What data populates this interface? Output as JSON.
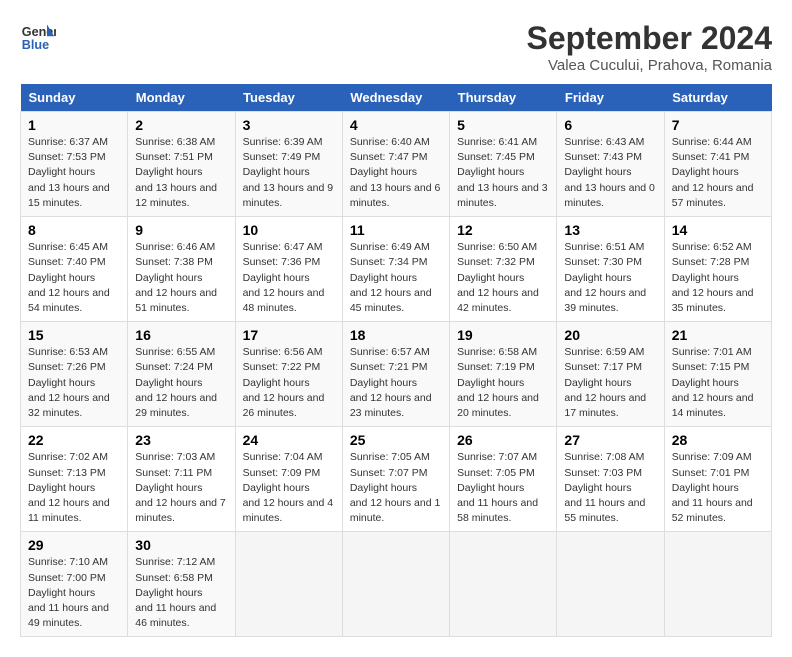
{
  "header": {
    "logo_line1": "General",
    "logo_line2": "Blue",
    "month": "September 2024",
    "location": "Valea Cucului, Prahova, Romania"
  },
  "weekdays": [
    "Sunday",
    "Monday",
    "Tuesday",
    "Wednesday",
    "Thursday",
    "Friday",
    "Saturday"
  ],
  "weeks": [
    [
      {
        "day": "1",
        "rise": "6:37 AM",
        "set": "7:53 PM",
        "daylight": "13 hours and 15 minutes."
      },
      {
        "day": "2",
        "rise": "6:38 AM",
        "set": "7:51 PM",
        "daylight": "13 hours and 12 minutes."
      },
      {
        "day": "3",
        "rise": "6:39 AM",
        "set": "7:49 PM",
        "daylight": "13 hours and 9 minutes."
      },
      {
        "day": "4",
        "rise": "6:40 AM",
        "set": "7:47 PM",
        "daylight": "13 hours and 6 minutes."
      },
      {
        "day": "5",
        "rise": "6:41 AM",
        "set": "7:45 PM",
        "daylight": "13 hours and 3 minutes."
      },
      {
        "day": "6",
        "rise": "6:43 AM",
        "set": "7:43 PM",
        "daylight": "13 hours and 0 minutes."
      },
      {
        "day": "7",
        "rise": "6:44 AM",
        "set": "7:41 PM",
        "daylight": "12 hours and 57 minutes."
      }
    ],
    [
      {
        "day": "8",
        "rise": "6:45 AM",
        "set": "7:40 PM",
        "daylight": "12 hours and 54 minutes."
      },
      {
        "day": "9",
        "rise": "6:46 AM",
        "set": "7:38 PM",
        "daylight": "12 hours and 51 minutes."
      },
      {
        "day": "10",
        "rise": "6:47 AM",
        "set": "7:36 PM",
        "daylight": "12 hours and 48 minutes."
      },
      {
        "day": "11",
        "rise": "6:49 AM",
        "set": "7:34 PM",
        "daylight": "12 hours and 45 minutes."
      },
      {
        "day": "12",
        "rise": "6:50 AM",
        "set": "7:32 PM",
        "daylight": "12 hours and 42 minutes."
      },
      {
        "day": "13",
        "rise": "6:51 AM",
        "set": "7:30 PM",
        "daylight": "12 hours and 39 minutes."
      },
      {
        "day": "14",
        "rise": "6:52 AM",
        "set": "7:28 PM",
        "daylight": "12 hours and 35 minutes."
      }
    ],
    [
      {
        "day": "15",
        "rise": "6:53 AM",
        "set": "7:26 PM",
        "daylight": "12 hours and 32 minutes."
      },
      {
        "day": "16",
        "rise": "6:55 AM",
        "set": "7:24 PM",
        "daylight": "12 hours and 29 minutes."
      },
      {
        "day": "17",
        "rise": "6:56 AM",
        "set": "7:22 PM",
        "daylight": "12 hours and 26 minutes."
      },
      {
        "day": "18",
        "rise": "6:57 AM",
        "set": "7:21 PM",
        "daylight": "12 hours and 23 minutes."
      },
      {
        "day": "19",
        "rise": "6:58 AM",
        "set": "7:19 PM",
        "daylight": "12 hours and 20 minutes."
      },
      {
        "day": "20",
        "rise": "6:59 AM",
        "set": "7:17 PM",
        "daylight": "12 hours and 17 minutes."
      },
      {
        "day": "21",
        "rise": "7:01 AM",
        "set": "7:15 PM",
        "daylight": "12 hours and 14 minutes."
      }
    ],
    [
      {
        "day": "22",
        "rise": "7:02 AM",
        "set": "7:13 PM",
        "daylight": "12 hours and 11 minutes."
      },
      {
        "day": "23",
        "rise": "7:03 AM",
        "set": "7:11 PM",
        "daylight": "12 hours and 7 minutes."
      },
      {
        "day": "24",
        "rise": "7:04 AM",
        "set": "7:09 PM",
        "daylight": "12 hours and 4 minutes."
      },
      {
        "day": "25",
        "rise": "7:05 AM",
        "set": "7:07 PM",
        "daylight": "12 hours and 1 minute."
      },
      {
        "day": "26",
        "rise": "7:07 AM",
        "set": "7:05 PM",
        "daylight": "11 hours and 58 minutes."
      },
      {
        "day": "27",
        "rise": "7:08 AM",
        "set": "7:03 PM",
        "daylight": "11 hours and 55 minutes."
      },
      {
        "day": "28",
        "rise": "7:09 AM",
        "set": "7:01 PM",
        "daylight": "11 hours and 52 minutes."
      }
    ],
    [
      {
        "day": "29",
        "rise": "7:10 AM",
        "set": "7:00 PM",
        "daylight": "11 hours and 49 minutes."
      },
      {
        "day": "30",
        "rise": "7:12 AM",
        "set": "6:58 PM",
        "daylight": "11 hours and 46 minutes."
      },
      null,
      null,
      null,
      null,
      null
    ]
  ]
}
